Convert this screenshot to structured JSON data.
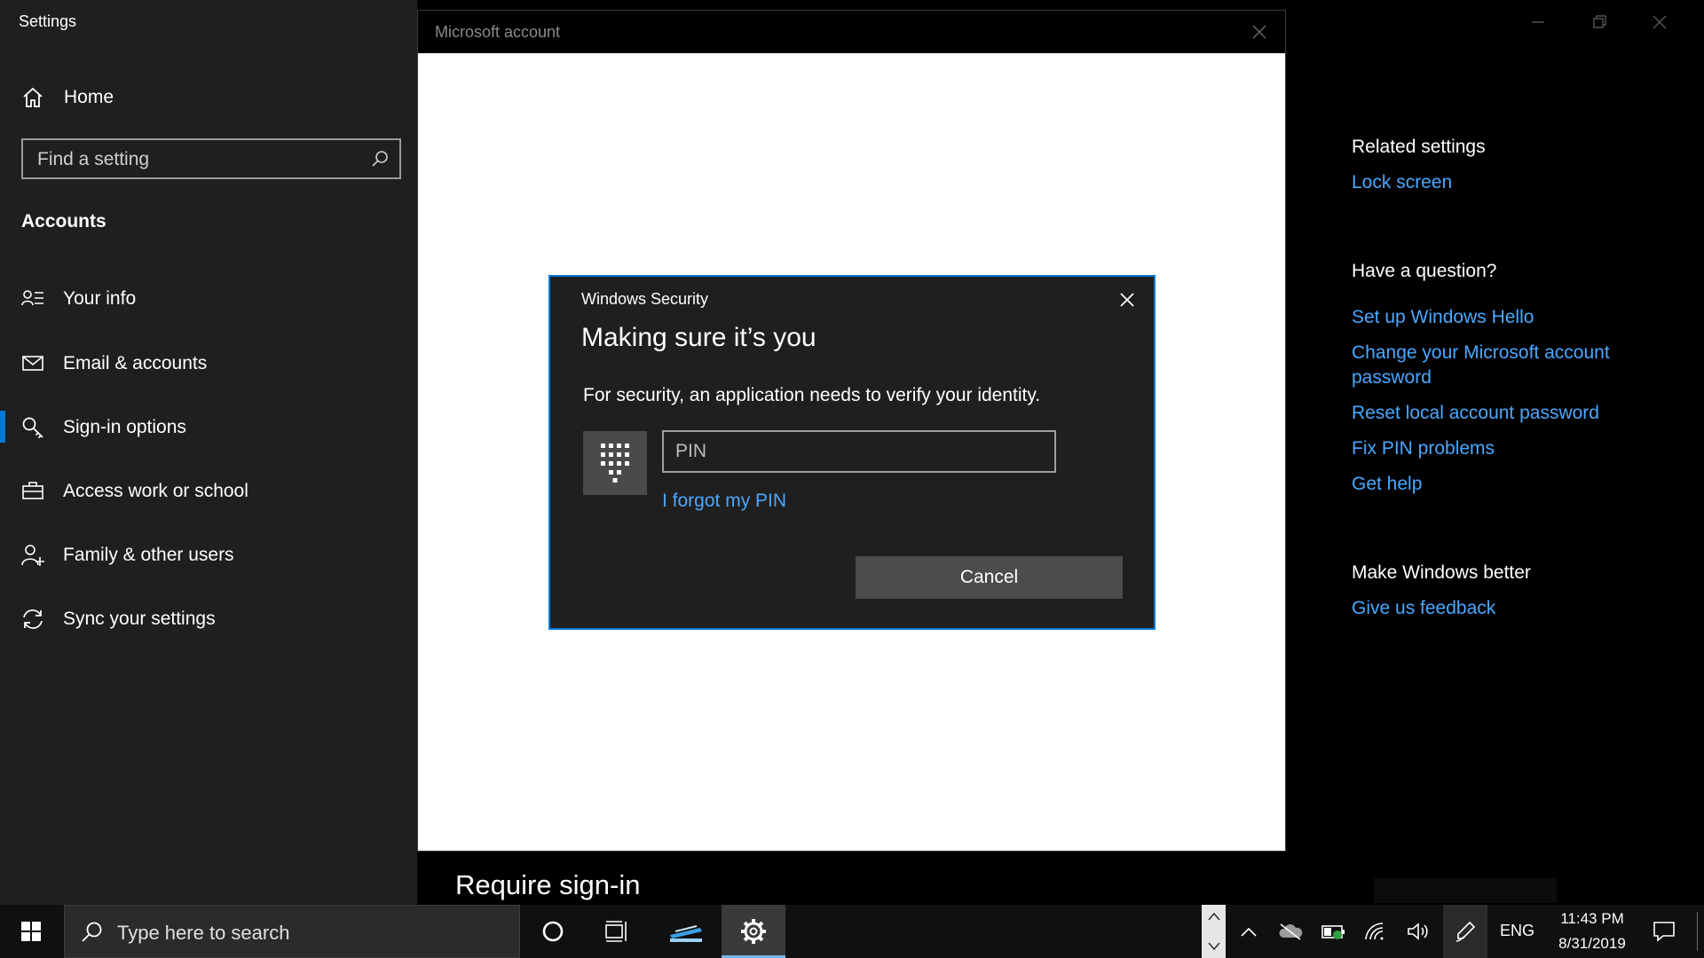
{
  "app": {
    "title": "Settings"
  },
  "sidebar": {
    "home": "Home",
    "search_placeholder": "Find a setting",
    "section": "Accounts",
    "items": [
      {
        "label": "Your info"
      },
      {
        "label": "Email & accounts"
      },
      {
        "label": "Sign-in options",
        "selected": true
      },
      {
        "label": "Access work or school"
      },
      {
        "label": "Family & other users"
      },
      {
        "label": "Sync your settings"
      }
    ]
  },
  "right": {
    "related_heading": "Related settings",
    "lock_screen": "Lock screen",
    "question_heading": "Have a question?",
    "links": [
      "Set up Windows Hello",
      "Change your Microsoft account password",
      "Reset local account password",
      "Fix PIN problems",
      "Get help"
    ],
    "better_heading": "Make Windows better",
    "feedback": "Give us feedback"
  },
  "main": {
    "require_signin": "Require sign-in"
  },
  "ms_dialog": {
    "title": "Microsoft account"
  },
  "security_dialog": {
    "app": "Windows Security",
    "heading": "Making sure it’s you",
    "message": "For security, an application needs to verify your identity.",
    "pin_placeholder": "PIN",
    "forgot": "I forgot my PIN",
    "cancel": "Cancel"
  },
  "taskbar": {
    "search_text": "Type here to search",
    "lang": "ENG",
    "time": "11:43 PM",
    "date": "8/31/2019"
  },
  "colors": {
    "accent": "#0078d7",
    "link": "#4aa8ff",
    "sidebar_bg": "#1f1f1f"
  }
}
